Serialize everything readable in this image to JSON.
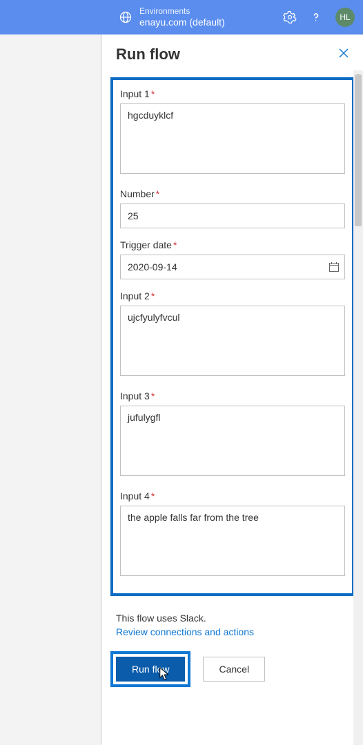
{
  "header": {
    "env_label": "Environments",
    "env_name": "enayu.com (default)",
    "avatar_initials": "HL"
  },
  "panel": {
    "title": "Run flow"
  },
  "fields": {
    "input1": {
      "label": "Input 1",
      "value": "hgcduyklcf"
    },
    "number": {
      "label": "Number",
      "value": "25"
    },
    "trigger_date": {
      "label": "Trigger date",
      "value": "2020-09-14"
    },
    "input2": {
      "label": "Input 2",
      "value": "ujcfyulyfvcul"
    },
    "input3": {
      "label": "Input 3",
      "value": "jufulygfl"
    },
    "input4": {
      "label": "Input 4",
      "value": "the apple falls far from the tree"
    }
  },
  "footer": {
    "uses_text": "This flow uses Slack.",
    "review_link": "Review connections and actions",
    "run_label": "Run flow",
    "cancel_label": "Cancel"
  },
  "required_marker": "*"
}
